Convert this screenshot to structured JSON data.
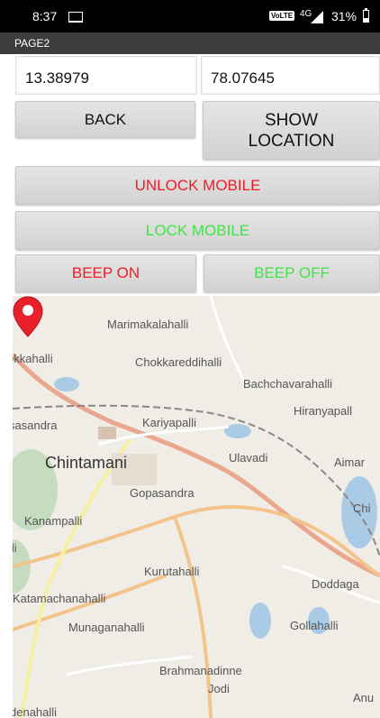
{
  "status_bar": {
    "time": "8:37",
    "volte": "VoLTE",
    "network": "4G",
    "battery": "31%"
  },
  "title": "PAGE2",
  "fields": {
    "latitude": "13.38979",
    "longitude": "78.07645"
  },
  "buttons": {
    "back": "BACK",
    "show_location": "SHOW LOCATION",
    "unlock": "UNLOCK MOBILE",
    "lock": "LOCK MOBILE",
    "beep_on": "BEEP ON",
    "beep_off": "BEEP OFF"
  },
  "colors": {
    "red": "#ee1c24",
    "green": "#41e447"
  },
  "map": {
    "places": {
      "marimakalahalli": "Marimakalahalli",
      "okkahalli": "okkahalli",
      "chokkareddihalli": "Chokkareddihalli",
      "bachchavarahalli": "Bachchavarahalli",
      "hiranyapalli": "Hiranyapall",
      "asandra": "sasandra",
      "kariyapalli": "Kariyapalli",
      "ulavadi": "Ulavadi",
      "aima": "Aimar",
      "chintamani": "Chintamani",
      "gopasandra": "Gopasandra",
      "chi": "Chi",
      "kanampalli": "Kanampalli",
      "li": "lli",
      "kurutahalli": "Kurutahalli",
      "doddaga": "Doddaga",
      "katamachanahalli": "Katamachanahalli",
      "munaganahalli": "Munaganahalli",
      "gollahalli": "Gollahalli",
      "brahmanadinne": "Brahmanadinne",
      "jodi": "Jodi",
      "anu": "Anu",
      "denahalli": "denahalli"
    }
  }
}
